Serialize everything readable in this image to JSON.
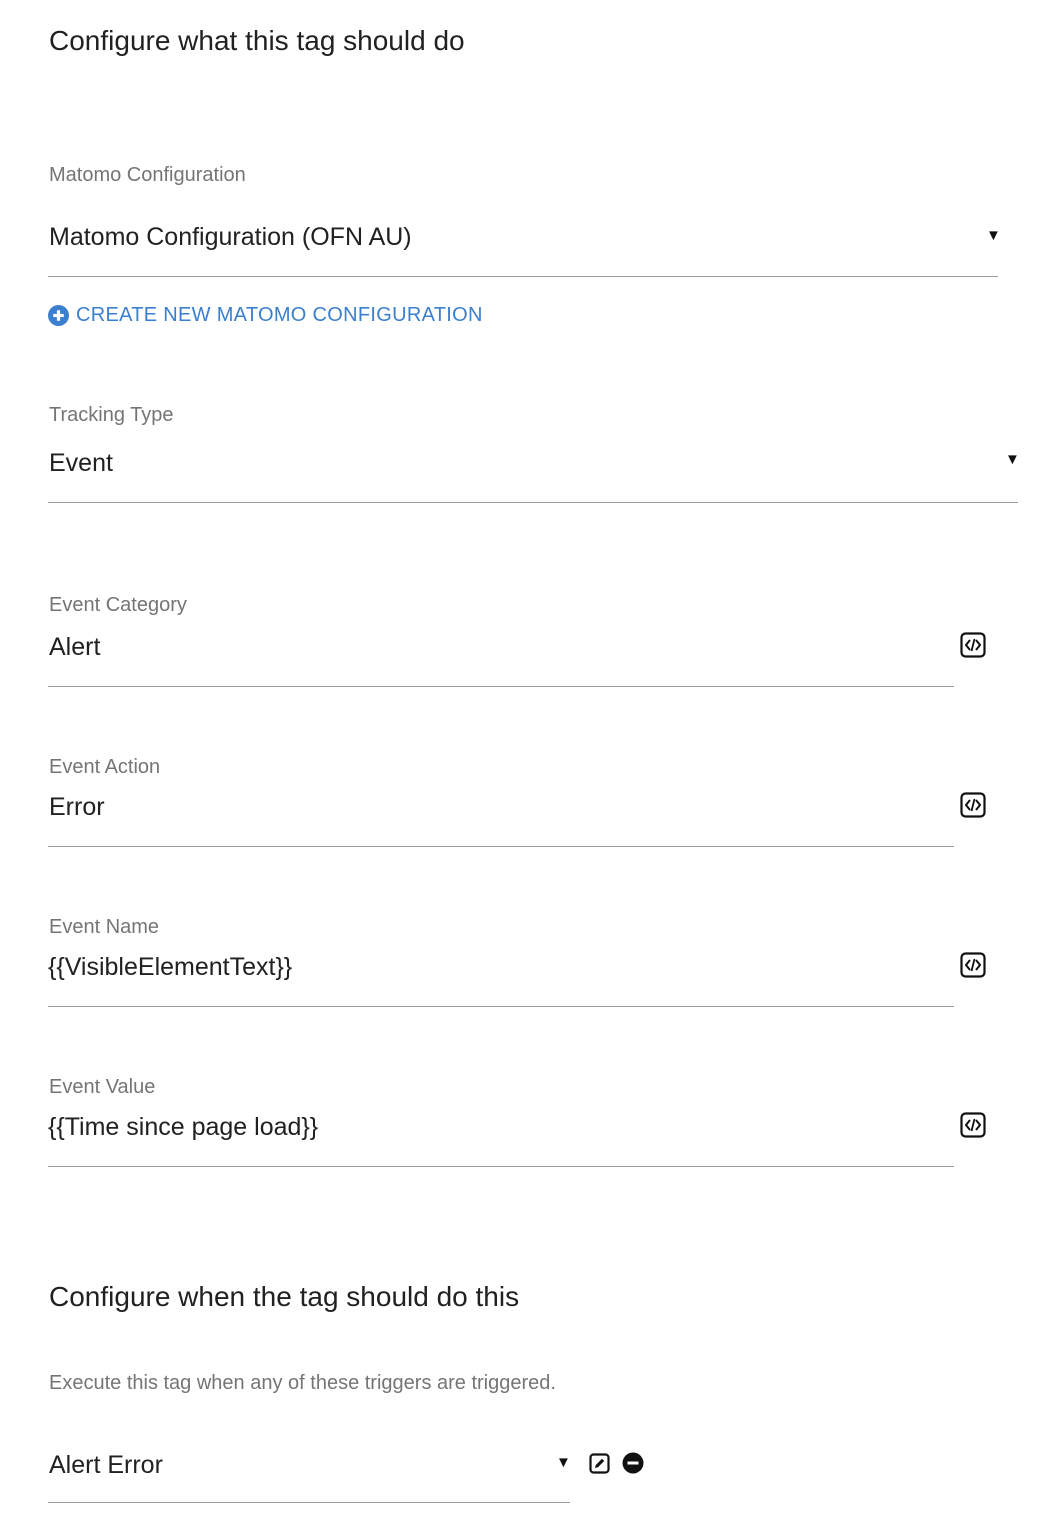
{
  "section_what": {
    "title": "Configure what this tag should do"
  },
  "matomo_config": {
    "label": "Matomo Configuration",
    "selected": "Matomo Configuration (OFN AU)",
    "create_link": "CREATE NEW MATOMO CONFIGURATION"
  },
  "tracking_type": {
    "label": "Tracking Type",
    "selected": "Event"
  },
  "event_category": {
    "label": "Event Category",
    "value": "Alert"
  },
  "event_action": {
    "label": "Event Action",
    "value": "Error"
  },
  "event_name": {
    "label": "Event Name",
    "value": "{{VisibleElementText}}"
  },
  "event_value": {
    "label": "Event Value",
    "value": "{{Time since page load}}"
  },
  "section_when": {
    "title": "Configure when the tag should do this",
    "help": "Execute this tag when any of these triggers are triggered."
  },
  "trigger": {
    "selected": "Alert Error"
  },
  "icons": {
    "dropdown": "caret-down-icon",
    "add": "plus-circle-icon",
    "variable": "variable-select-icon",
    "edit": "edit-icon",
    "remove": "minus-circle-icon"
  }
}
